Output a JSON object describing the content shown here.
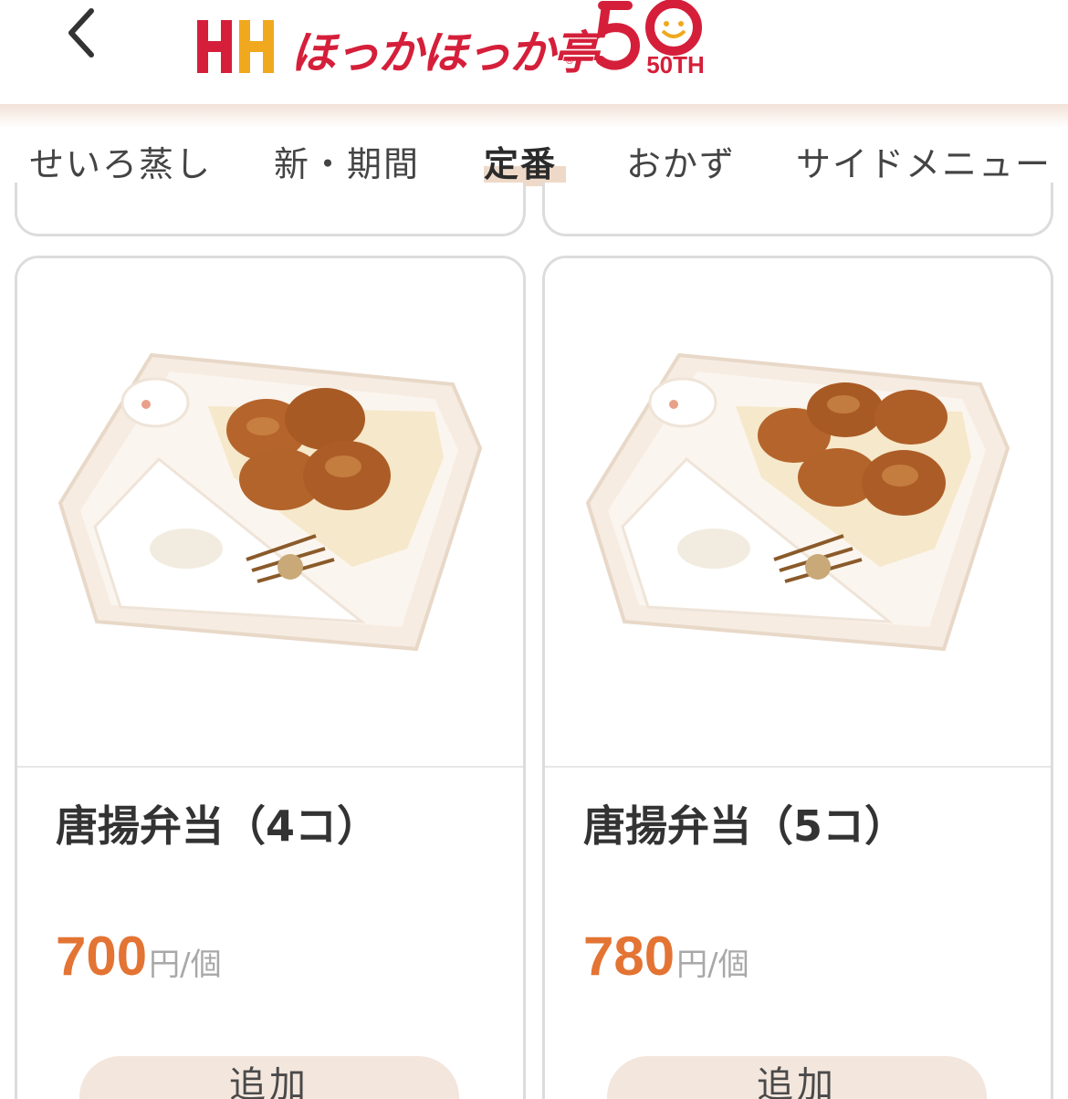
{
  "header": {
    "back_label": "<",
    "brand_name": "ほっかほっか亭",
    "anniversary": "50TH",
    "brand_color": "#d51f3a",
    "accent_color": "#e37434"
  },
  "tabs": [
    {
      "label": "せいろ蒸し",
      "active": false
    },
    {
      "label": "新・期間",
      "active": false
    },
    {
      "label": "定番",
      "active": true
    },
    {
      "label": "おかず",
      "active": false
    },
    {
      "label": "サイドメニュー",
      "active": false
    }
  ],
  "products": [
    {
      "name": "唐揚弁当（4コ）",
      "price": "700",
      "unit": "円/個",
      "button": "追加",
      "karaage_count": 4
    },
    {
      "name": "唐揚弁当（5コ）",
      "price": "780",
      "unit": "円/個",
      "button": "追加",
      "karaage_count": 5
    }
  ]
}
